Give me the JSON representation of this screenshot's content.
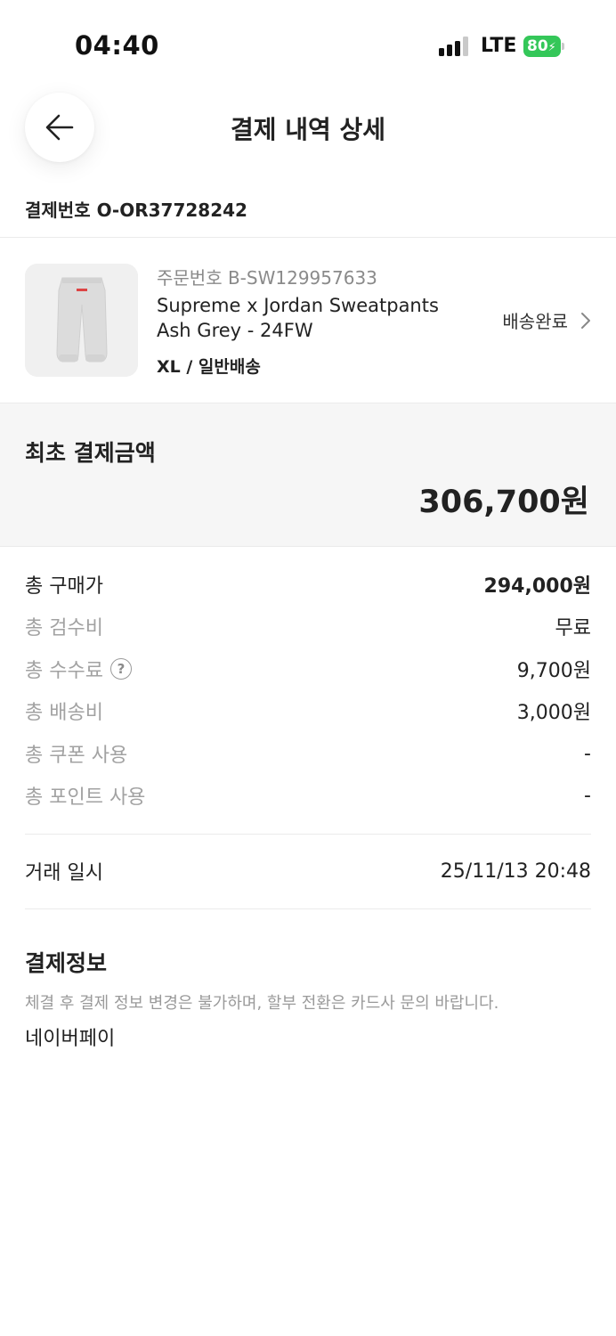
{
  "status_bar": {
    "time": "04:40",
    "network": "LTE",
    "battery": "80"
  },
  "header": {
    "title": "결제 내역 상세",
    "back_icon": "arrow-left-icon"
  },
  "payment_number": "결제번호 O-OR37728242",
  "product": {
    "order_number": "주문번호 B-SW129957633",
    "name": "Supreme x Jordan Sweatpants Ash Grey - 24FW",
    "option": "XL / 일반배송",
    "status": "배송완료",
    "status_icon": "chevron-right-icon"
  },
  "total": {
    "label": "최초 결제금액",
    "amount": "306,700원"
  },
  "breakdown": [
    {
      "label": "총 구매가",
      "value": "294,000원"
    },
    {
      "label": "총 검수비",
      "value": "무료"
    },
    {
      "label": "총 수수료",
      "value": "9,700원",
      "help_icon": "?"
    },
    {
      "label": "총 배송비",
      "value": "3,000원"
    },
    {
      "label": "총 쿠폰 사용",
      "value": "-"
    },
    {
      "label": "총 포인트 사용",
      "value": "-"
    }
  ],
  "transaction": {
    "label": "거래 일시",
    "value": "25/11/13 20:48"
  },
  "payment_info": {
    "title": "결제정보",
    "note": "체결 후 결제 정보 변경은 불가하며, 할부 전환은 카드사 문의 바랍니다.",
    "method": "네이버페이"
  },
  "colors": {
    "battery": "#34c759",
    "total_bg": "#f6f6f6",
    "muted_text": "#a2a2a2"
  }
}
